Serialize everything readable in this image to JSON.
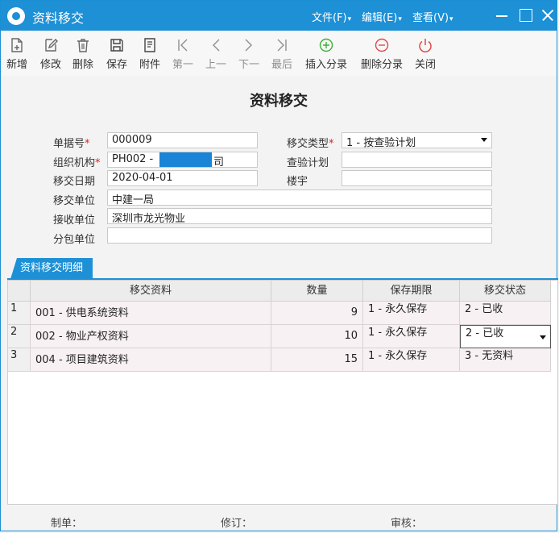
{
  "window": {
    "title": "资料移交",
    "menu": [
      "文件(F)",
      "编辑(E)",
      "查看(V)"
    ]
  },
  "toolbar": [
    {
      "name": "new",
      "label": "新增",
      "icon": "new-doc-icon",
      "enabled": true
    },
    {
      "name": "edit",
      "label": "修改",
      "icon": "pencil-icon",
      "enabled": true
    },
    {
      "name": "delete",
      "label": "删除",
      "icon": "trash-icon",
      "enabled": true
    },
    {
      "name": "save",
      "label": "保存",
      "icon": "floppy-icon",
      "enabled": true
    },
    {
      "name": "attach",
      "label": "附件",
      "icon": "document-icon",
      "enabled": true
    },
    {
      "name": "first",
      "label": "第一",
      "icon": "first-icon",
      "enabled": false
    },
    {
      "name": "prev",
      "label": "上一",
      "icon": "prev-icon",
      "enabled": false
    },
    {
      "name": "next",
      "label": "下一",
      "icon": "next-icon",
      "enabled": false
    },
    {
      "name": "last",
      "label": "最后",
      "icon": "last-icon",
      "enabled": false
    },
    {
      "name": "insert-row",
      "label": "插入分录",
      "icon": "plus-circle-icon",
      "enabled": true
    },
    {
      "name": "delete-row",
      "label": "删除分录",
      "icon": "minus-circle-icon",
      "enabled": true
    },
    {
      "name": "close",
      "label": "关闭",
      "icon": "power-icon",
      "enabled": true
    }
  ],
  "colors": {
    "accent": "#1d90d6",
    "insert": "#3cb034",
    "delete": "#e04848",
    "required": "#e02020"
  },
  "form": {
    "heading": "资料移交",
    "doc_no": {
      "label": "单据号",
      "value": "000009"
    },
    "transfer_type": {
      "label": "移交类型",
      "value": "1 - 按查验计划"
    },
    "org": {
      "label": "组织机构",
      "value": "PH002 - 深圳市龙光",
      "visible_value": "PH002 - ",
      "visible_tail": "司"
    },
    "inspection_plan": {
      "label": "查验计划",
      "value": ""
    },
    "transfer_date": {
      "label": "移交日期",
      "value": "2020-04-01"
    },
    "building": {
      "label": "楼宇",
      "value": ""
    },
    "transfer_unit": {
      "label": "移交单位",
      "value": "中建一局"
    },
    "receiving_unit": {
      "label": "接收单位",
      "value": "深圳市龙光物业"
    },
    "subcontract_unit": {
      "label": "分包单位",
      "value": ""
    },
    "required_mark": "*"
  },
  "detail": {
    "tab_label": "资料移交明细",
    "columns": [
      "移交资料",
      "数量",
      "保存期限",
      "移交状态"
    ],
    "rows": [
      {
        "num": "1",
        "material": "001 - 供电系统资料",
        "qty": "9",
        "retention": "1 - 永久保存",
        "status": "2 - 已收"
      },
      {
        "num": "2",
        "material": "002 - 物业产权资料",
        "qty": "10",
        "retention": "1 - 永久保存",
        "status": "2 - 已收"
      },
      {
        "num": "3",
        "material": "004 - 项目建筑资料",
        "qty": "15",
        "retention": "1 - 永久保存",
        "status": "3 - 无资料"
      }
    ]
  },
  "footer": {
    "maker_label": "制单：",
    "revise_label": "修订：",
    "audit_label": "审核："
  }
}
